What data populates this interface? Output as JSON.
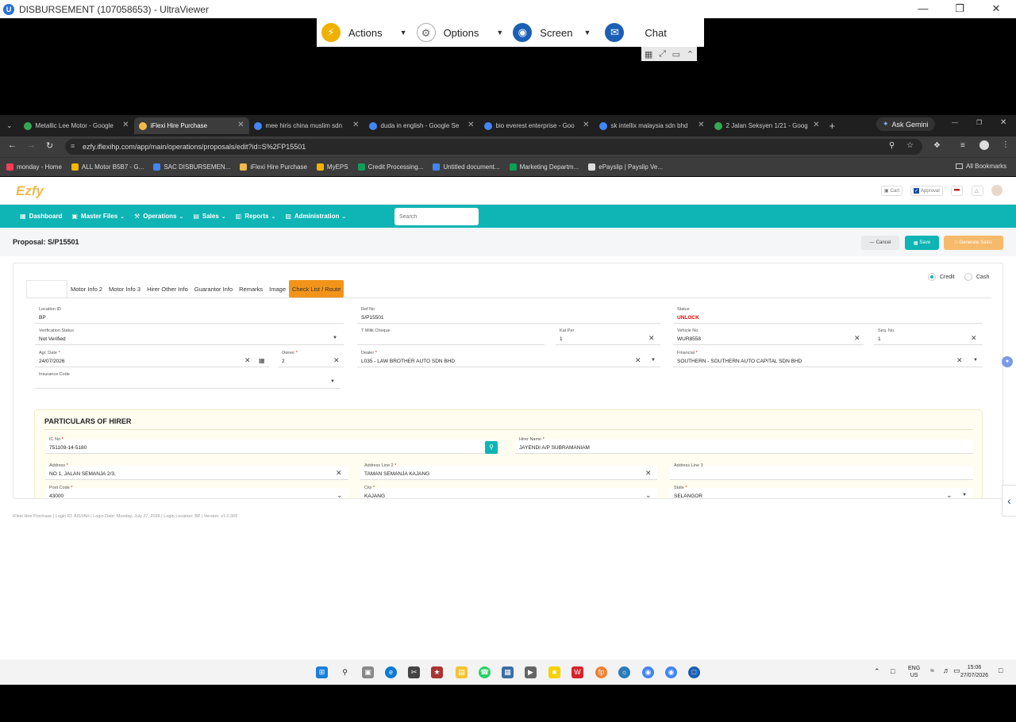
{
  "ultraviewer": {
    "title": "DISBURSEMENT (107058653) - UltraViewer",
    "toolbar": {
      "actions": "Actions",
      "options": "Options",
      "screen": "Screen",
      "chat": "Chat"
    }
  },
  "browser": {
    "tabs": [
      {
        "label": "Metallic Lee Motor - Google",
        "color": "#34a853"
      },
      {
        "label": "iFlexi Hire Purchase",
        "color": "#f0b94a"
      },
      {
        "label": "mee hiris china muslim sdn",
        "color": "#4285f4"
      },
      {
        "label": "duda in english - Google Se",
        "color": "#4285f4"
      },
      {
        "label": "bio everest enterprise - Goo",
        "color": "#4285f4"
      },
      {
        "label": "sk intellix malaysia sdn bhd",
        "color": "#4285f4"
      },
      {
        "label": "2 Jalan Seksyen 1/21 - Goog",
        "color": "#34a853"
      }
    ],
    "ask_gemini": "Ask Gemini",
    "url": "ezfy.iflexihp.com/app/main/operations/proposals/edit?id=S%2FP15501",
    "bookmarks": [
      {
        "label": "monday - Home",
        "color": "#ff3d57"
      },
      {
        "label": "ALL Motor B5B7 - G...",
        "color": "#f4b400"
      },
      {
        "label": "SAC DISBURSEMEN...",
        "color": "#4285f4"
      },
      {
        "label": "iFlexi Hire Purchase",
        "color": "#f0b94a"
      },
      {
        "label": "MyEPS",
        "color": "#f4b400"
      },
      {
        "label": "Credit Processing...",
        "color": "#0f9d58"
      },
      {
        "label": "Untitled document...",
        "color": "#4285f4"
      },
      {
        "label": "Marketing Departm...",
        "color": "#0f9d58"
      },
      {
        "label": "ePayslip | Payslip Ve...",
        "color": "#dddddd"
      }
    ],
    "all_bookmarks": "All Bookmarks"
  },
  "app": {
    "logo": "Ezfy",
    "header_pills": {
      "cart": "Cart",
      "approval": "Approval"
    },
    "nav": [
      {
        "label": "Dashboard",
        "icon": "dashboard-icon",
        "caret": false
      },
      {
        "label": "Master Files",
        "icon": "folder-icon",
        "caret": true
      },
      {
        "label": "Operations",
        "icon": "wrench-icon",
        "caret": true
      },
      {
        "label": "Sales",
        "icon": "document-icon",
        "caret": true
      },
      {
        "label": "Reports",
        "icon": "chart-icon",
        "caret": true
      },
      {
        "label": "Administration",
        "icon": "admin-icon",
        "caret": true
      }
    ],
    "search_placeholder": "Search",
    "proposal_title": "Proposal: S/P15501",
    "buttons": {
      "cancel": "Cancel",
      "save": "Save",
      "generate_sales": "Generate Sales"
    },
    "tabs": [
      "Motor Info 2",
      "Motor Info 3",
      "Hirer Other Info",
      "Guarantor Info",
      "Remarks",
      "Image",
      "Check List / Route"
    ],
    "active_tab": "Check List / Route",
    "payment_options": [
      "Credit",
      "Cash"
    ],
    "payment_selected": "Credit",
    "form": {
      "location_id": {
        "label": "Location ID",
        "value": "BP"
      },
      "ref_no": {
        "label": "Ref No",
        "value": "S/P15501"
      },
      "status": {
        "label": "Status",
        "value": "UNLOCK"
      },
      "verification_status": {
        "label": "Verification Status",
        "value": "Not Verified"
      },
      "t_milik_cheque": {
        "label": "T Milik Cheque",
        "value": ""
      },
      "kat_per": {
        "label": "Kat Per",
        "value": "1"
      },
      "vehicle_no": {
        "label": "Vehicle No.",
        "value": "WUR8558"
      },
      "seq_no": {
        "label": "Seq. No.",
        "value": "1"
      },
      "agr_date": {
        "label": "Agr. Date",
        "value": "24/07/2026"
      },
      "owner": {
        "label": "Owner",
        "value": "2"
      },
      "dealer": {
        "label": "Dealer",
        "value": "L035 - LAW BROTHER AUTO SDN BHD"
      },
      "financial": {
        "label": "Financial",
        "value": "SOUTHERN - SOUTHERN AUTO CAPITAL SDN BHD"
      },
      "insurance_code": {
        "label": "Insurance Code",
        "value": ""
      }
    },
    "hirer": {
      "title": "PARTICULARS OF HIRER",
      "ic_no": {
        "label": "IC No",
        "value": "751109-14-5180"
      },
      "hirer_name": {
        "label": "Hirer Name",
        "value": "JAYENDI A/P SUBRAMANIAM"
      },
      "address": {
        "label": "Address",
        "value": "NO 1, JALAN SEMANJA 2/3,"
      },
      "address2": {
        "label": "Address Line 2",
        "value": "TAMAN SEMANJA KAJANG"
      },
      "address3": {
        "label": "Address Line 3",
        "value": ""
      },
      "post_code": {
        "label": "Post Code",
        "value": "43000"
      },
      "city": {
        "label": "City",
        "value": "KAJANG"
      },
      "state": {
        "label": "State",
        "value": "SELANGOR"
      }
    },
    "footer": "iFlexi Hire Purchase | Login ID: AISYAH | Login Date: Monday, July 27, 2026 | Login Location: BP | Version: v1.0.365"
  },
  "taskbar": {
    "lang": "ENG",
    "region": "US",
    "time": "15:06",
    "date": "27/07/2026"
  }
}
